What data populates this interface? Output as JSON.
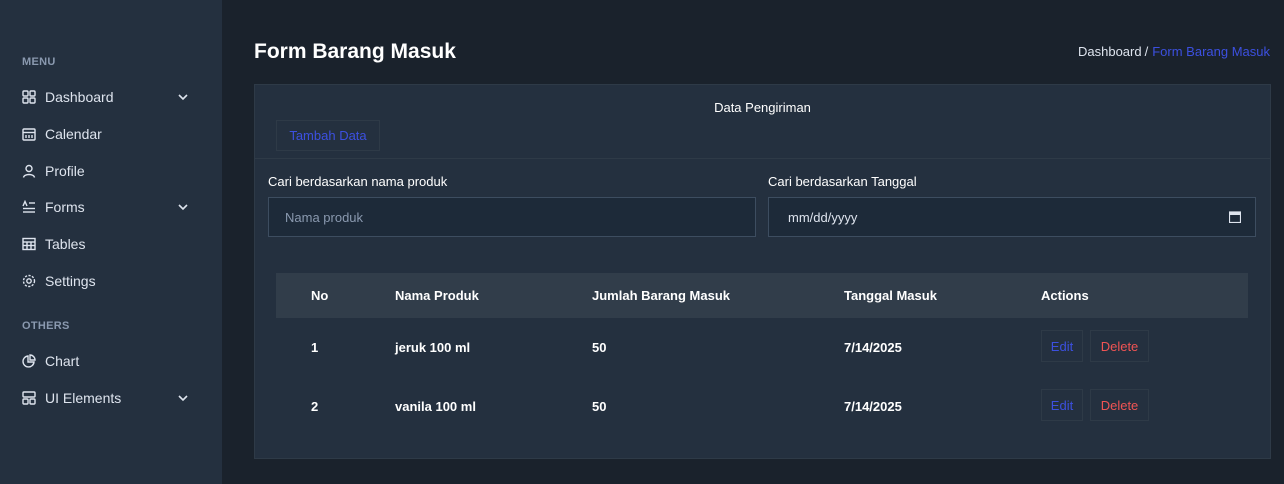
{
  "sidebar": {
    "menu_heading": "MENU",
    "others_heading": "OTHERS",
    "items": [
      {
        "label": "Dashboard",
        "icon": "dashboard-grid-icon"
      },
      {
        "label": "Calendar",
        "icon": "calendar-icon"
      },
      {
        "label": "Profile",
        "icon": "user-icon"
      },
      {
        "label": "Forms",
        "icon": "forms-icon"
      },
      {
        "label": "Tables",
        "icon": "table-icon"
      },
      {
        "label": "Settings",
        "icon": "gear-icon"
      },
      {
        "label": "Chart",
        "icon": "pie-chart-icon"
      },
      {
        "label": "UI Elements",
        "icon": "ui-elements-icon"
      }
    ]
  },
  "header": {
    "title": "Form Barang Masuk",
    "breadcrumb": {
      "home": "Dashboard",
      "separator": "/",
      "current": "Form Barang Masuk"
    }
  },
  "card": {
    "title": "Data Pengiriman",
    "add_button": "Tambah Data",
    "search_name": {
      "label": "Cari berdasarkan nama produk",
      "placeholder": "Nama produk"
    },
    "search_date": {
      "label": "Cari berdasarkan Tanggal",
      "value": "mm/dd/yyyy"
    }
  },
  "table": {
    "headers": [
      "No",
      "Nama Produk",
      "Jumlah Barang Masuk",
      "Tanggal Masuk",
      "Actions"
    ],
    "rows": [
      {
        "no": "1",
        "nama": "jeruk 100 ml",
        "jumlah": "50",
        "tanggal": "7/14/2025"
      },
      {
        "no": "2",
        "nama": "vanila 100 ml",
        "jumlah": "50",
        "tanggal": "7/14/2025"
      }
    ],
    "edit_label": "Edit",
    "delete_label": "Delete"
  },
  "colors": {
    "accent": "#3c50e0",
    "danger": "#f05454",
    "sidebar_bg": "#24303f",
    "page_bg": "#1a222c"
  }
}
